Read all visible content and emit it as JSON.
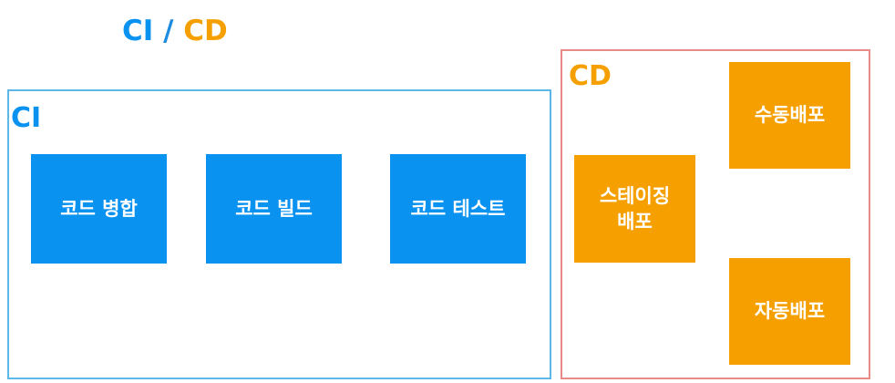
{
  "title": {
    "ci": "CI",
    "separator": "/",
    "cd": "CD"
  },
  "ci_section": {
    "label": "CI",
    "steps": [
      "코드 병합",
      "코드 빌드",
      "코드 테스트"
    ]
  },
  "cd_section": {
    "label": "CD",
    "steps": [
      "스테이징\n배포",
      "수동배포",
      "자동배포"
    ]
  },
  "colors": {
    "ci_blue": "#0a92f0",
    "cd_orange": "#f5a000",
    "ci_frame": "#5cb8e6",
    "cd_frame": "#e88a85"
  }
}
